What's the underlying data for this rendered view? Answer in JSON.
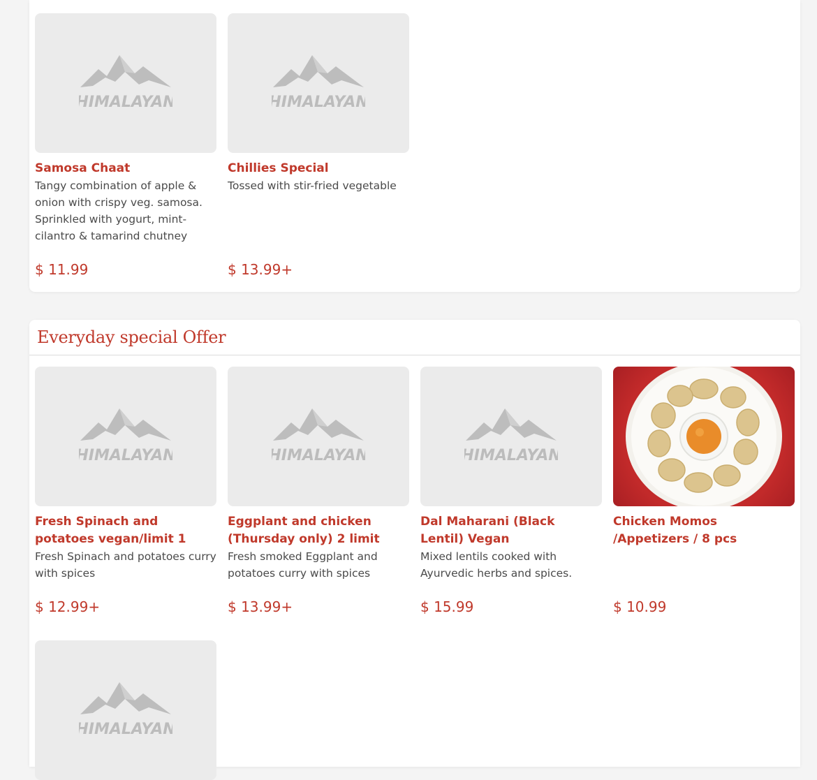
{
  "sections": {
    "top": {
      "items": [
        {
          "name": "Samosa Chaat",
          "description": "Tangy combination of apple & onion with crispy veg. samosa. Sprinkled with yogurt, mint-cilantro & tamarind chutney",
          "price": "$ 11.99"
        },
        {
          "name": "Chillies Special",
          "description": "Tossed with stir-fried vegetable",
          "price": "$ 13.99+"
        }
      ]
    },
    "offer": {
      "title": "Everyday special Offer",
      "items": [
        {
          "name": "Fresh Spinach and potatoes vegan/limit 1",
          "description": "Fresh Spinach and potatoes curry with spices",
          "price": "$ 12.99+"
        },
        {
          "name": "Eggplant and chicken (Thursday only) 2 limit",
          "description": "Fresh smoked Eggplant and potatoes curry with spices",
          "price": "$ 13.99+"
        },
        {
          "name": "Dal Maharani (Black Lentil) Vegan",
          "description": "Mixed lentils cooked with Ayurvedic herbs and spices.",
          "price": "$ 15.99"
        },
        {
          "name": "Chicken Momos /Appetizers / 8 pcs",
          "description": "",
          "price": "$ 10.99"
        }
      ]
    }
  },
  "placeholder_logo_text": "HIMALAYAN",
  "colors": {
    "accent": "#c0392b",
    "background": "#f4f4f4",
    "thumb_placeholder": "#ebebeb",
    "text": "#4a4a4a"
  }
}
